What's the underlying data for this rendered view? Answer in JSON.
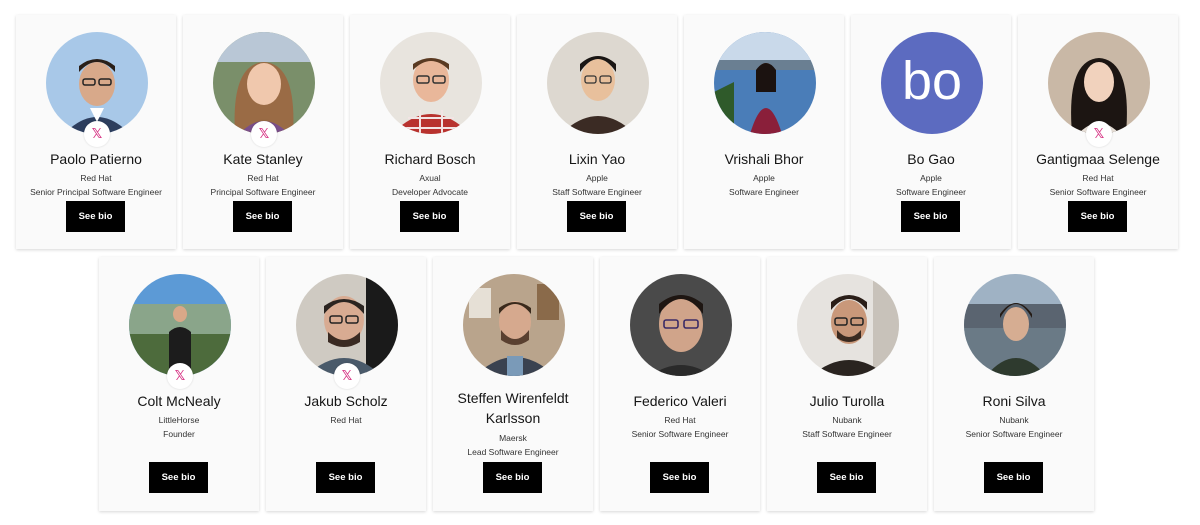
{
  "colors": {
    "badge_x": "#d63384",
    "button_bg": "#000000",
    "card_bg": "#fafafa"
  },
  "speakers_row1": [
    {
      "name": "Paolo Patierno",
      "company": "Red Hat",
      "title": "Senior Principal Software Engineer",
      "button": "See bio",
      "x_badge": "𝕏"
    },
    {
      "name": "Kate Stanley",
      "company": "Red Hat",
      "title": "Principal Software Engineer",
      "button": "See bio",
      "x_badge": "𝕏"
    },
    {
      "name": "Richard Bosch",
      "company": "Axual",
      "title": "Developer Advocate",
      "button": "See bio"
    },
    {
      "name": "Lixin Yao",
      "company": "Apple",
      "title": "Staff Software Engineer",
      "button": "See bio"
    },
    {
      "name": "Vrishali Bhor",
      "company": "Apple",
      "title": "Software Engineer",
      "button": ""
    },
    {
      "name": "Bo Gao",
      "company": "Apple",
      "title": "Software Engineer",
      "button": "See bio",
      "avatar_text": "bo"
    },
    {
      "name": "Gantigmaa Selenge",
      "company": "Red Hat",
      "title": "Senior Software Engineer",
      "button": "See bio",
      "x_badge": "𝕏"
    }
  ],
  "speakers_row2": [
    {
      "name": "Colt McNealy",
      "company": "LittleHorse",
      "title": "Founder",
      "button": "See bio",
      "x_badge": "𝕏"
    },
    {
      "name": "Jakub Scholz",
      "company": "Red Hat",
      "title": "",
      "button": "See bio",
      "x_badge": "𝕏"
    },
    {
      "name": "Steffen Wirenfeldt Karlsson",
      "company": "Maersk",
      "title": "Lead Software Engineer",
      "button": "See bio"
    },
    {
      "name": "Federico Valeri",
      "company": "Red Hat",
      "title": "Senior Software Engineer",
      "button": "See bio"
    },
    {
      "name": "Julio Turolla",
      "company": "Nubank",
      "title": "Staff Software Engineer",
      "button": "See bio"
    },
    {
      "name": "Roni Silva",
      "company": "Nubank",
      "title": "Senior Software Engineer",
      "button": "See bio"
    }
  ]
}
